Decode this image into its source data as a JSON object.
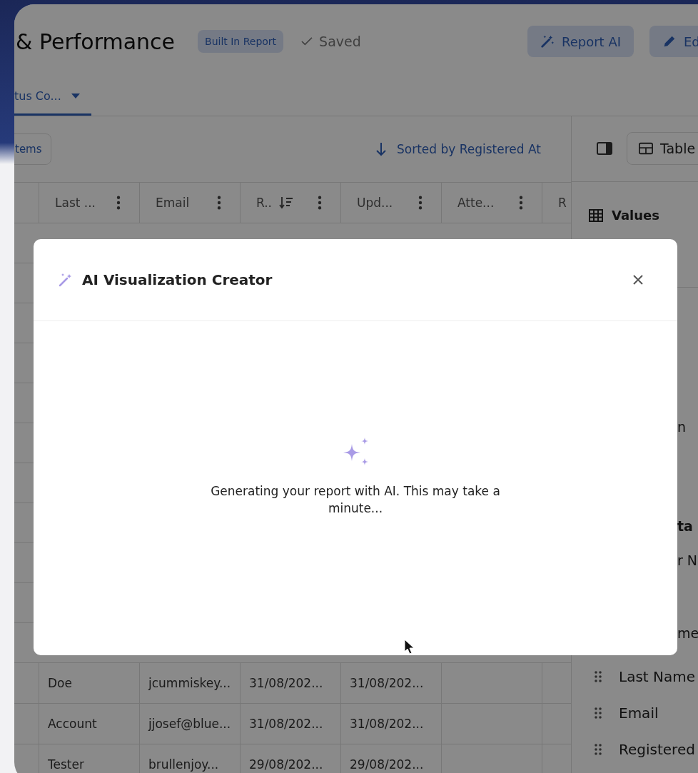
{
  "header": {
    "title": "& Performance",
    "badge": "Built In Report",
    "saved": "Saved",
    "buttons": [
      {
        "label": "Report AI",
        "kind": "wand"
      },
      {
        "label": "Ed",
        "kind": "pencil"
      }
    ]
  },
  "tabs": [
    {
      "label": "tus Co...",
      "selected": true
    }
  ],
  "toolbar": {
    "items_button": "tems",
    "sort": "Sorted by Registered At"
  },
  "table": {
    "columns": [
      {
        "label": "Last ...",
        "sorted": false
      },
      {
        "label": "Email",
        "sorted": false
      },
      {
        "label": "R..",
        "sorted": true
      },
      {
        "label": "Upd...",
        "sorted": false
      },
      {
        "label": "Atte...",
        "sorted": false
      },
      {
        "label": "R"
      }
    ],
    "rows": [
      [
        "Doe",
        "jcummiskey...",
        "31/08/202...",
        "31/08/202...",
        ""
      ],
      [
        "Account",
        "jjosef@blue...",
        "31/08/202...",
        "31/08/202...",
        ""
      ],
      [
        "Tester",
        "brullenjoy...",
        "29/08/202...",
        "29/08/202...",
        ""
      ]
    ]
  },
  "panel": {
    "view_button": "Table",
    "values_label": "Values",
    "fragments": [
      {
        "text": "n",
        "bold": false
      },
      {
        "text": "ta",
        "bold": true
      },
      {
        "text": "r N",
        "bold": false
      },
      {
        "text": "me",
        "bold": false
      }
    ],
    "fields": [
      "Last Name",
      "Email",
      "Registered"
    ]
  },
  "modal": {
    "title": "AI Visualization Creator",
    "message": "Generating your report with AI. This may take a minute..."
  }
}
